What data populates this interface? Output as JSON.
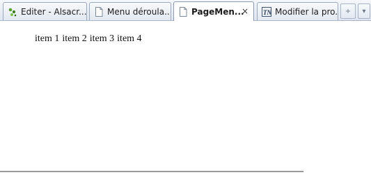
{
  "tabs": [
    {
      "label": "Editer - Alsacr...",
      "icon": "alsacreations-icon",
      "active": false
    },
    {
      "label": "Menu déroula...",
      "icon": "page-icon",
      "active": false
    },
    {
      "label": "PageMen...",
      "icon": "page-icon",
      "active": true,
      "close": "×"
    },
    {
      "label": "Modifier la pro...",
      "icon": "tn-icon",
      "active": false
    }
  ],
  "controls": {
    "new_tab": "+",
    "list_all_tabs": "▾"
  },
  "content": {
    "items": [
      "item 1",
      "item 2",
      "item 3",
      "item 4"
    ]
  }
}
